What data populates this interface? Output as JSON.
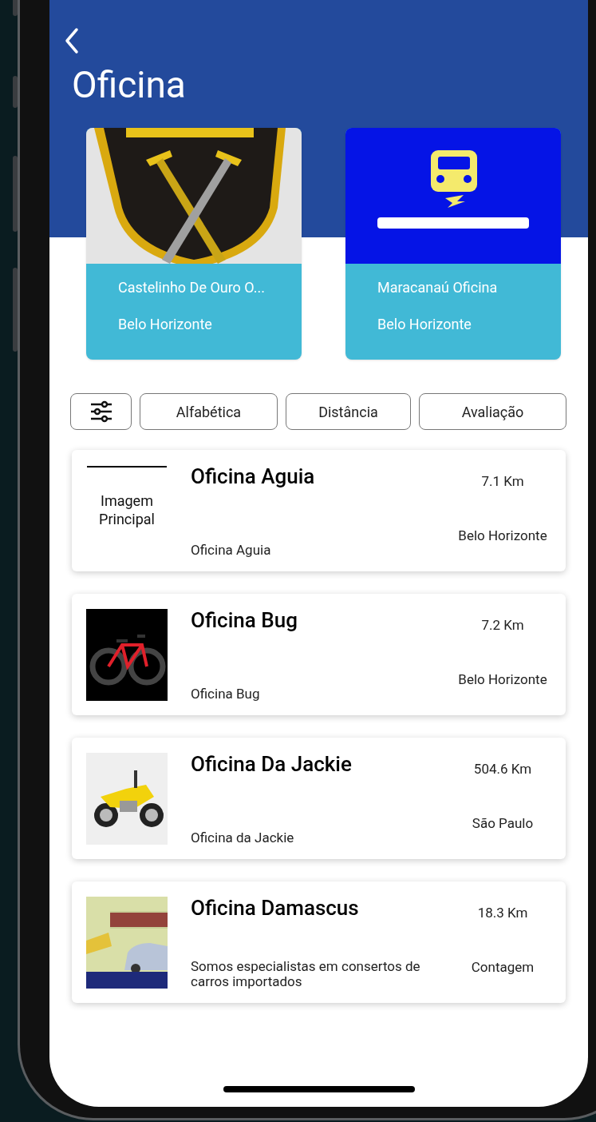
{
  "header": {
    "title": "Oficina"
  },
  "featured": [
    {
      "name": "Castelinho De Ouro O...",
      "city": "Belo Horizonte"
    },
    {
      "name": "Maracanaú Oficina",
      "city": "Belo Horizonte"
    }
  ],
  "sort_buttons": [
    "Alfabética",
    "Distância",
    "Avaliação"
  ],
  "workshops": [
    {
      "title": "Oficina Aguia",
      "description": "Oficina Aguia",
      "distance": "7.1 Km",
      "city": "Belo Horizonte",
      "image": {
        "kind": "placeholder",
        "text": "Imagem Principal"
      }
    },
    {
      "title": "Oficina Bug",
      "description": "Oficina Bug",
      "distance": "7.2 Km",
      "city": "Belo Horizonte"
    },
    {
      "title": "Oficina Da Jackie",
      "description": "Oficina da Jackie",
      "distance": "504.6 Km",
      "city": "São Paulo"
    },
    {
      "title": "Oficina Damascus",
      "description": "Somos especialistas em consertos de carros importados",
      "distance": "18.3 Km",
      "city": "Contagem"
    }
  ]
}
